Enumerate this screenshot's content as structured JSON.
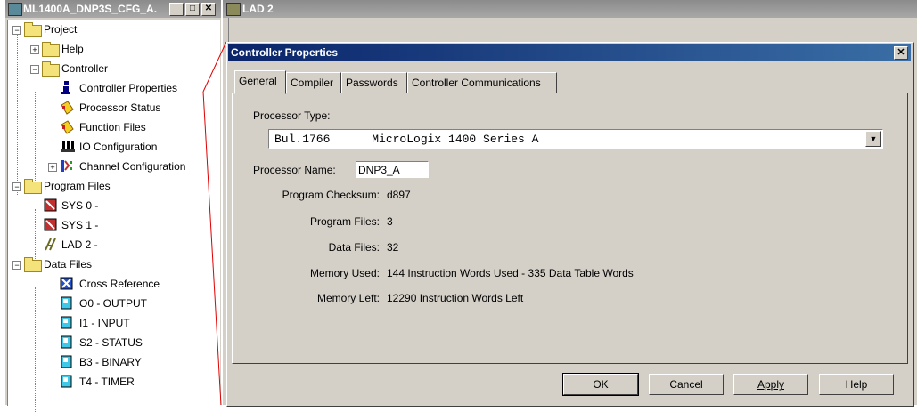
{
  "tree_window": {
    "title": "ML1400A_DNP3S_CFG_A...",
    "buttons": {
      "minimize": "_",
      "maximize": "□",
      "close": "✕"
    },
    "items": [
      {
        "label": "Project",
        "icon": "folder-icon"
      },
      {
        "label": "Help",
        "icon": "folder-icon"
      },
      {
        "label": "Controller",
        "icon": "folder-icon"
      },
      {
        "label": "Controller Properties",
        "icon": "info-icon"
      },
      {
        "label": "Processor Status",
        "icon": "processor-status-icon"
      },
      {
        "label": "Function Files",
        "icon": "function-files-icon"
      },
      {
        "label": "IO Configuration",
        "icon": "io-config-icon"
      },
      {
        "label": "Channel Configuration",
        "icon": "channel-config-icon"
      },
      {
        "label": "Program Files",
        "icon": "folder-icon"
      },
      {
        "label": "SYS 0 -",
        "icon": "sys-file-icon"
      },
      {
        "label": "SYS 1 -",
        "icon": "sys-file-icon"
      },
      {
        "label": "LAD 2 -",
        "icon": "ladder-icon"
      },
      {
        "label": "Data Files",
        "icon": "folder-icon"
      },
      {
        "label": "Cross Reference",
        "icon": "cross-reference-icon"
      },
      {
        "label": "O0 - OUTPUT",
        "icon": "data-file-icon"
      },
      {
        "label": "I1 - INPUT",
        "icon": "data-file-icon"
      },
      {
        "label": "S2 - STATUS",
        "icon": "data-file-icon"
      },
      {
        "label": "B3 - BINARY",
        "icon": "data-file-icon"
      },
      {
        "label": "T4 - TIMER",
        "icon": "data-file-icon"
      }
    ]
  },
  "lad_window": {
    "title": "LAD 2"
  },
  "dialog": {
    "title": "Controller Properties",
    "close": "✕",
    "tabs": [
      "General",
      "Compiler",
      "Passwords",
      "Controller Communications"
    ],
    "active_tab": "General",
    "processor_type_label": "Processor Type:",
    "processor_type_value": "Bul.1766      MicroLogix 1400 Series A",
    "processor_name_label": "Processor Name:",
    "processor_name_value": "DNP3_A",
    "program_checksum_label": "Program Checksum:",
    "program_checksum_value": "d897",
    "program_files_label": "Program Files:",
    "program_files_value": "3",
    "data_files_label": "Data Files:",
    "data_files_value": "32",
    "memory_used_label": "Memory Used:",
    "memory_used_value": "144 Instruction Words Used - 335 Data Table Words",
    "memory_left_label": "Memory Left:",
    "memory_left_value": "12290 Instruction Words Left",
    "buttons": {
      "ok": "OK",
      "cancel": "Cancel",
      "apply": "Apply",
      "help": "Help"
    }
  },
  "colors": {
    "title_active": "#0a246a",
    "title_inactive": "#8b8b8b",
    "face": "#d4d0c8",
    "annotation_line": "#e00000"
  }
}
